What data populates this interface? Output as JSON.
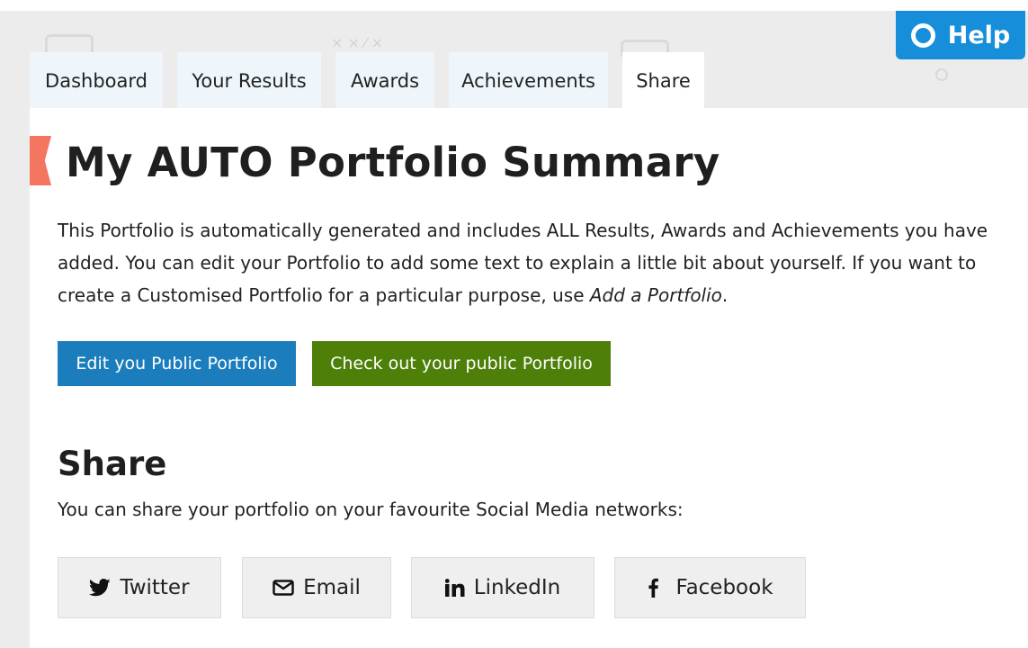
{
  "tabs": [
    {
      "label": "Dashboard"
    },
    {
      "label": "Your Results"
    },
    {
      "label": "Awards"
    },
    {
      "label": "Achievements"
    },
    {
      "label": "Share",
      "active": true
    }
  ],
  "help": {
    "label": "Help",
    "icon": "help-ring-icon"
  },
  "page": {
    "title": "My AUTO Portfolio Summary",
    "intro_text": "This Portfolio is automatically generated and includes ALL Results, Awards and Achievements you have added. You can edit your Portfolio to add some text to explain a little bit about yourself. If you want to create a Customised Portfolio for a particular purpose, use ",
    "intro_link": "Add a Portfolio",
    "intro_end": "."
  },
  "buttons": {
    "edit_label": "Edit you Public Portfolio",
    "check_label": "Check out your public Portfolio"
  },
  "share": {
    "heading": "Share",
    "text": "You can share your portfolio on your favourite Social Media networks:",
    "networks": [
      {
        "label": "Twitter",
        "icon": "twitter-icon"
      },
      {
        "label": "Email",
        "icon": "envelope-icon"
      },
      {
        "label": "LinkedIn",
        "icon": "linkedin-icon"
      },
      {
        "label": "Facebook",
        "icon": "facebook-icon"
      }
    ]
  },
  "colors": {
    "accent_blue": "#1c7dbd",
    "accent_green": "#4e7f09",
    "help_blue": "#168ed9",
    "ribbon": "#f47560"
  }
}
